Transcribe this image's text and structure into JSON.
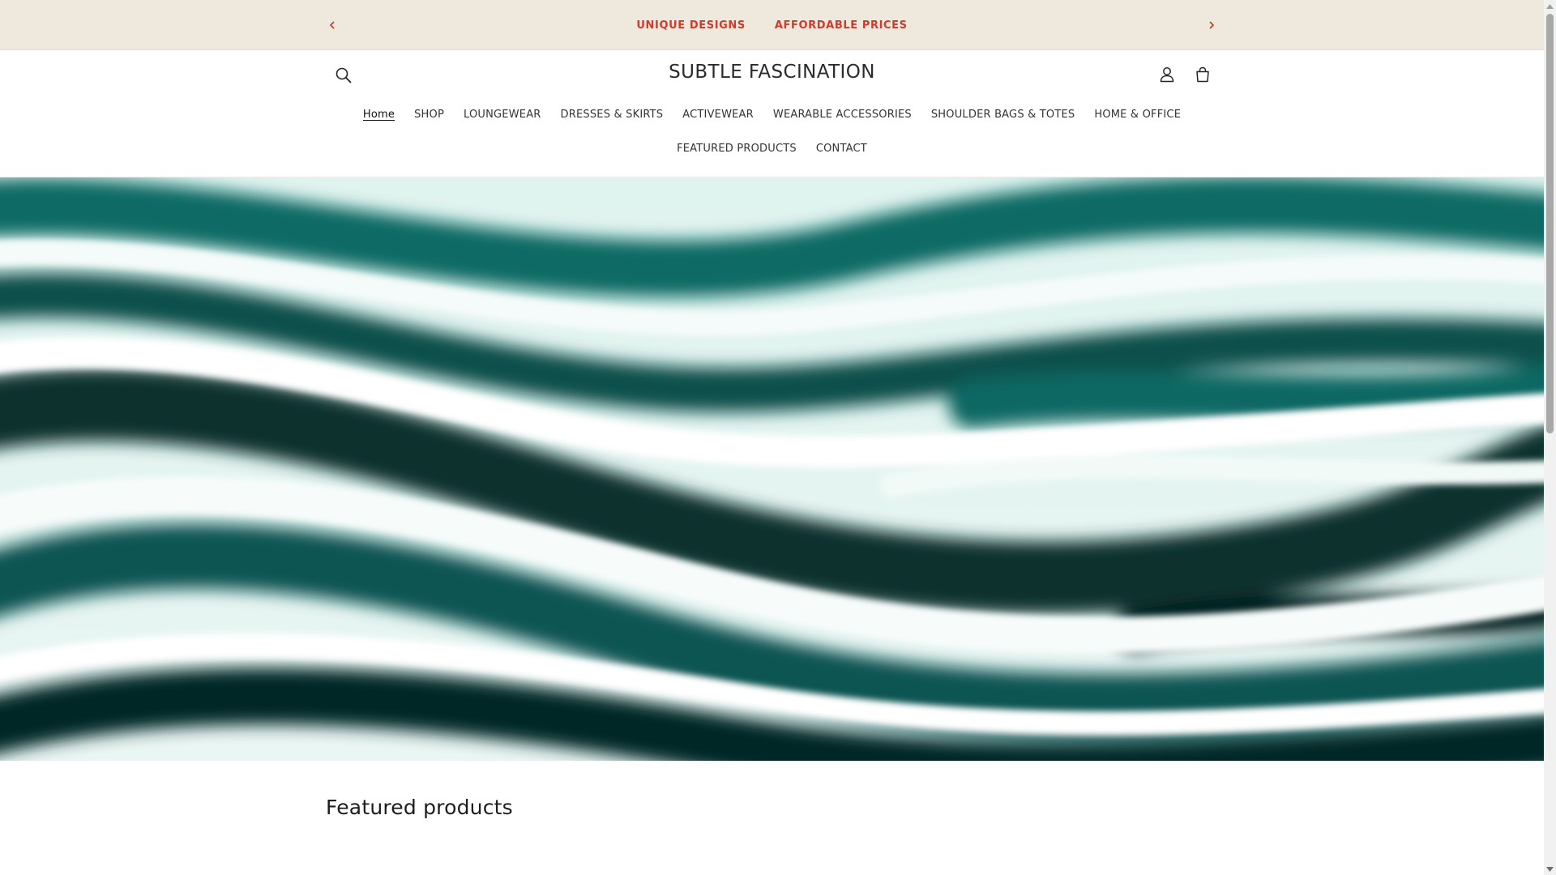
{
  "announcement": {
    "messages": [
      "UNIQUE DESIGNS",
      "AFFORDABLE PRICES"
    ],
    "prev_icon": "chevron-left-icon",
    "next_icon": "chevron-right-icon",
    "text_color": "#d1392a",
    "background": "#efe8dc"
  },
  "header": {
    "brand": "SUBTLE FASCINATION",
    "search_icon": "search-icon",
    "account_icon": "user-icon",
    "cart_icon": "bag-icon"
  },
  "nav": {
    "row1": [
      "Home",
      "SHOP",
      "LOUNGEWEAR",
      "DRESSES & SKIRTS",
      "ACTIVEWEAR",
      "WEARABLE ACCESSORIES",
      "SHOULDER BAGS & TOTES",
      "HOME & OFFICE"
    ],
    "row2": [
      "FEATURED PRODUCTS",
      "CONTACT"
    ],
    "active": "Home"
  },
  "featured": {
    "title": "Featured products"
  },
  "colors": {
    "accent": "#d1392a",
    "hero_teal": "#0e5e5a"
  }
}
